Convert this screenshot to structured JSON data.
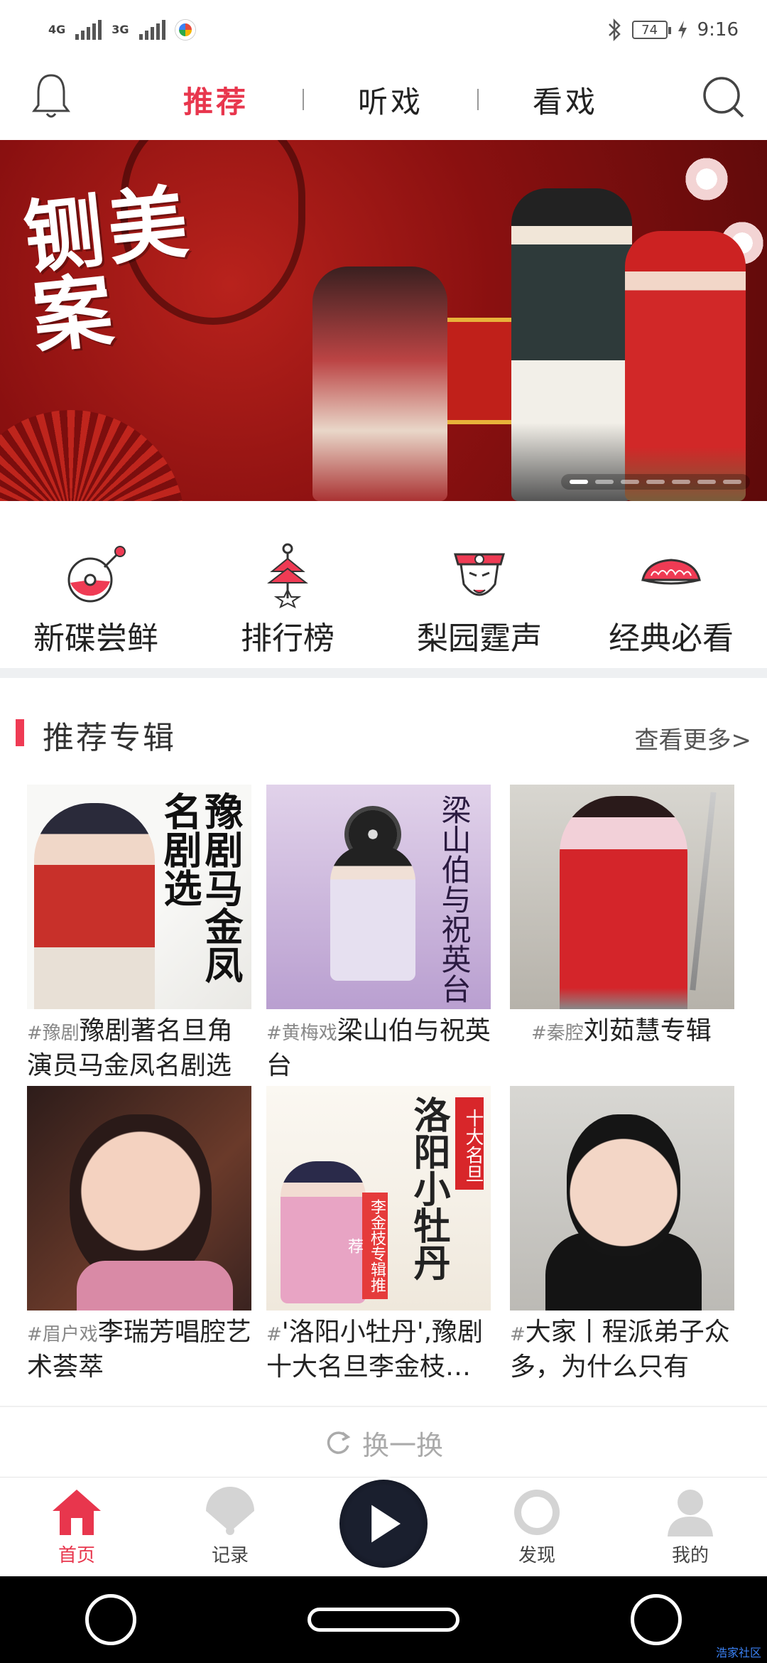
{
  "status_bar": {
    "net1": "4G",
    "net2": "3G",
    "battery": "74",
    "time": "9:16"
  },
  "header": {
    "tabs": [
      {
        "label": "推荐",
        "active": true
      },
      {
        "label": "听戏",
        "active": false
      },
      {
        "label": "看戏",
        "active": false
      }
    ]
  },
  "banner": {
    "title": "铡美案",
    "dots": 7,
    "active_dot": 1
  },
  "categories": [
    {
      "label": "新碟尝鲜",
      "icon": "new-disc-icon"
    },
    {
      "label": "排行榜",
      "icon": "ranking-icon"
    },
    {
      "label": "梨园霆声",
      "icon": "opera-mask-icon"
    },
    {
      "label": "经典必看",
      "icon": "classic-icon"
    }
  ],
  "section": {
    "title": "推荐专辑",
    "more": "查看更多>"
  },
  "albums": [
    {
      "tag": "#豫剧",
      "title": "豫剧著名旦角演员马金凤名剧选",
      "cover_text": "豫剧马金凤名剧选"
    },
    {
      "tag": "#黄梅戏",
      "title": "梁山伯与祝英台",
      "cover_text": "梁山伯与祝英台"
    },
    {
      "tag": "#秦腔",
      "title": "刘茹慧专辑",
      "cover_text": ""
    },
    {
      "tag": "#眉户戏",
      "title": "李瑞芳唱腔艺术荟萃",
      "cover_text": ""
    },
    {
      "tag": "#",
      "title": "'洛阳小牡丹',豫剧十大名旦李金枝…",
      "cover_text": "洛阳小牡丹",
      "badge": "十大名旦",
      "badge2": "李金枝专辑推荐"
    },
    {
      "tag": "#",
      "title": "大家丨程派弟子众多，为什么只有张…",
      "cover_text": ""
    }
  ],
  "refresh": {
    "label": "换一换"
  },
  "tabbar": [
    {
      "label": "首页",
      "icon": "home-icon",
      "active": true
    },
    {
      "label": "记录",
      "icon": "fan-icon",
      "active": false
    },
    {
      "label": "",
      "icon": "play-icon",
      "active": false
    },
    {
      "label": "发现",
      "icon": "discover-icon",
      "active": false
    },
    {
      "label": "我的",
      "icon": "profile-icon",
      "active": false
    }
  ],
  "watermark": "浩家社区",
  "colors": {
    "accent": "#e8364d",
    "accent_bar": "#ef3b54"
  }
}
